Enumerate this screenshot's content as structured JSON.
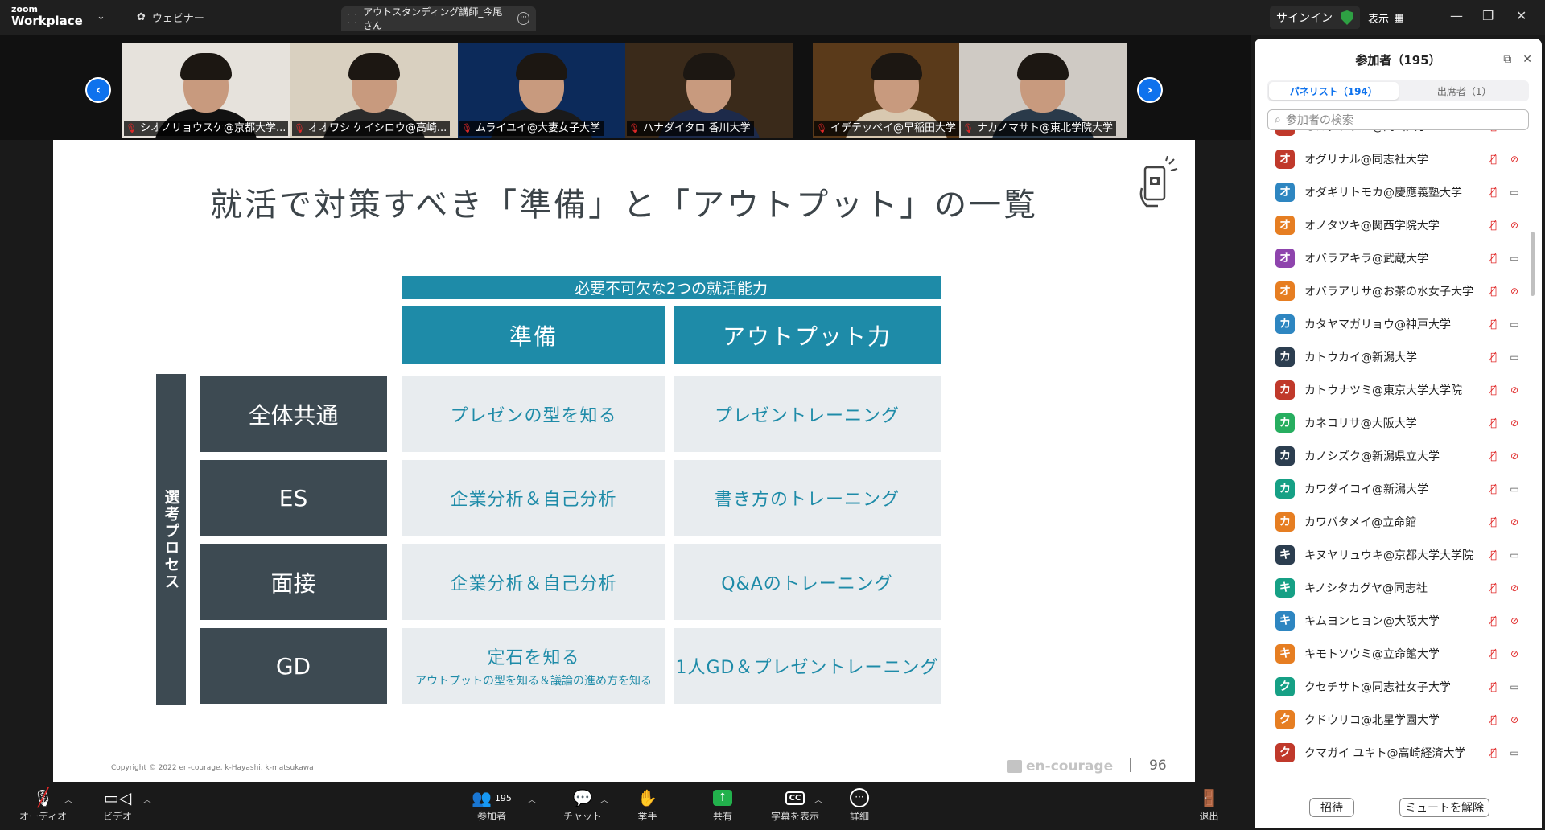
{
  "titlebar": {
    "logo_small": "zoom",
    "logo_big": "Workplace",
    "webinar_label": "ウェビナー",
    "tab_title": "アウトスタンディング講師_今尾 さん",
    "signin": "サインイン",
    "view_label": "表示"
  },
  "videos": [
    {
      "name": "シオノリョウスケ@京都大学...",
      "bg": "#e6e2dc",
      "shirt": "#111111"
    },
    {
      "name": "オオワシ ケイシロウ@高崎...",
      "bg": "#d9d0c0",
      "shirt": "#2b2b2b"
    },
    {
      "name": "ムライユイ@大妻女子大学",
      "bg": "#0c2a5a",
      "shirt": "#1a1a1a"
    },
    {
      "name": "ハナダイタロ 香川大学",
      "bg": "#3a2a1a",
      "shirt": "#1d2a4a"
    },
    {
      "name": "イデテッペイ@早稲田大学",
      "bg": "#5a3a1a",
      "shirt": "#d8c8b0"
    },
    {
      "name": "ナカノマサト@東北学院大学",
      "bg": "#cfcac4",
      "shirt": "#2a3a4a"
    }
  ],
  "slide": {
    "title": "就活で対策すべき「準備」と「アウトプット」の一覧",
    "banner": "必要不可欠な2つの就活能力",
    "col_headers": [
      "準備",
      "アウトプット力"
    ],
    "vertical_label": "選考プロセス",
    "rows": [
      {
        "head": "全体共通",
        "prep": "プレゼンの型を知る",
        "prep_sub": "",
        "output": "プレゼントレーニング"
      },
      {
        "head": "ES",
        "prep": "企業分析＆自己分析",
        "prep_sub": "",
        "output": "書き方のトレーニング"
      },
      {
        "head": "面接",
        "prep": "企業分析＆自己分析",
        "prep_sub": "",
        "output": "Q&Aのトレーニング"
      },
      {
        "head": "GD",
        "prep": "定石を知る",
        "prep_sub": "アウトプットの型を知る＆議論の進め方を知る",
        "output": "1人GD＆プレゼントレーニング"
      }
    ],
    "copyright": "Copyright © 2022 en-courage, k-Hayashi, k-matsukawa",
    "brand": "en-courage",
    "page_number": "96"
  },
  "toolbar": {
    "audio": "オーディオ",
    "video": "ビデオ",
    "participants": "参加者",
    "participants_count": "195",
    "chat": "チャット",
    "raise_hand": "挙手",
    "share": "共有",
    "captions": "字幕を表示",
    "more": "詳細",
    "leave": "退出"
  },
  "panel": {
    "title": "参加者（195）",
    "tab_panelists": "パネリスト（194）",
    "tab_attendees": "出席者（1）",
    "search_placeholder": "参加者の検索",
    "invite": "招待",
    "unmute": "ミュートを解除",
    "participants": [
      {
        "initial": "オ",
        "name": "オカダナデミ@岡山大学",
        "color": "#c0392b",
        "cam": false
      },
      {
        "initial": "オ",
        "name": "オグリナル@同志社大学",
        "color": "#c0392b",
        "cam": false
      },
      {
        "initial": "オ",
        "name": "オダギリトモカ@慶應義塾大学",
        "color": "#2e86c1",
        "cam": true
      },
      {
        "initial": "オ",
        "name": "オノタツキ@関西学院大学",
        "color": "#e67e22",
        "cam": false
      },
      {
        "initial": "オ",
        "name": "オバラアキラ@武蔵大学",
        "color": "#8e44ad",
        "cam": true
      },
      {
        "initial": "オ",
        "name": "オバラアリサ@お茶の水女子大学",
        "color": "#e67e22",
        "cam": false
      },
      {
        "initial": "カ",
        "name": "カタヤマガリョウ@神戸大学",
        "color": "#2e86c1",
        "cam": true
      },
      {
        "initial": "カ",
        "name": "カトウカイ@新潟大学",
        "color": "#2c3e50",
        "cam": true
      },
      {
        "initial": "カ",
        "name": "カトウナツミ@東京大学大学院",
        "color": "#c0392b",
        "cam": false
      },
      {
        "initial": "カ",
        "name": "カネコリサ@大阪大学",
        "color": "#27ae60",
        "cam": false
      },
      {
        "initial": "カ",
        "name": "カノシズク@新潟県立大学",
        "color": "#2c3e50",
        "cam": false
      },
      {
        "initial": "カ",
        "name": "カワダイコイ@新潟大学",
        "color": "#16a085",
        "cam": true
      },
      {
        "initial": "カ",
        "name": "カワバタメイ@立命館",
        "color": "#e67e22",
        "cam": false
      },
      {
        "initial": "キ",
        "name": "キヌヤリュウキ@京都大学大学院",
        "color": "#2c3e50",
        "cam": true
      },
      {
        "initial": "キ",
        "name": "キノシタカグヤ@同志社",
        "color": "#16a085",
        "cam": false
      },
      {
        "initial": "キ",
        "name": "キムヨンヒョン@大阪大学",
        "color": "#2e86c1",
        "cam": false
      },
      {
        "initial": "キ",
        "name": "キモトソウミ@立命館大学",
        "color": "#e67e22",
        "cam": false
      },
      {
        "initial": "ク",
        "name": "クセチサト@同志社女子大学",
        "color": "#16a085",
        "cam": true
      },
      {
        "initial": "ク",
        "name": "クドウリコ@北星学園大学",
        "color": "#e67e22",
        "cam": false
      },
      {
        "initial": "ク",
        "name": "クマガイ ユキト@高崎経済大学",
        "color": "#c0392b",
        "cam": true
      }
    ]
  }
}
